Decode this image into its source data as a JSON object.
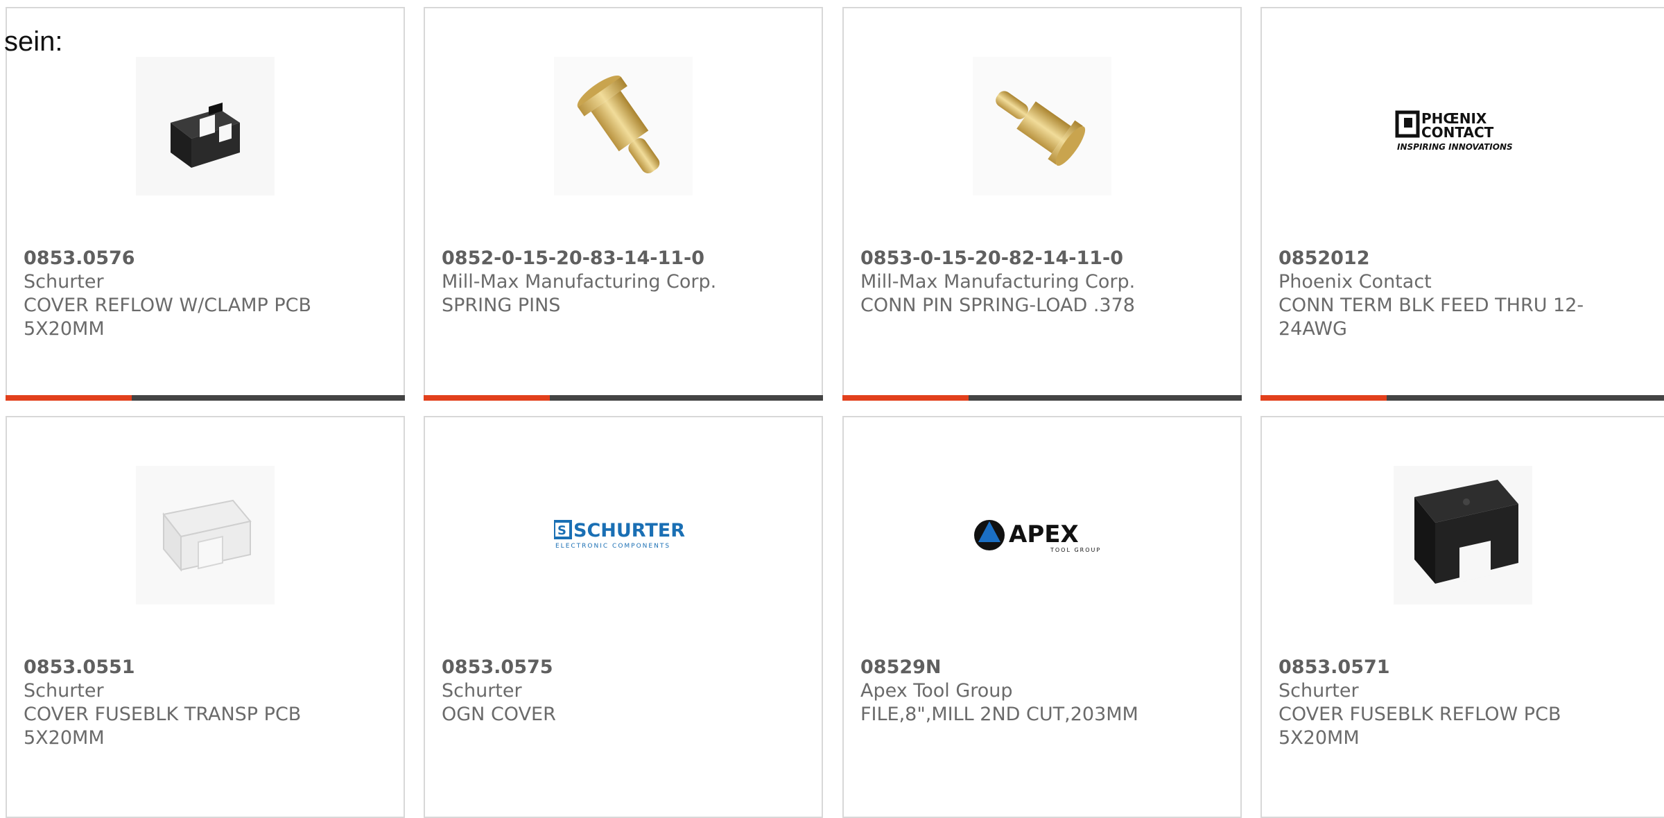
{
  "intro_text": "sein:",
  "products": [
    {
      "part_number": "0853.0576",
      "manufacturer": "Schurter",
      "description": "COVER REFLOW W/CLAMP PCB 5X20MM",
      "image": "black-fuse-clamp"
    },
    {
      "part_number": "0852-0-15-20-83-14-11-0",
      "manufacturer": "Mill-Max Manufacturing Corp.",
      "description": "SPRING PINS",
      "image": "gold-spring-pin"
    },
    {
      "part_number": "0853-0-15-20-82-14-11-0",
      "manufacturer": "Mill-Max Manufacturing Corp.",
      "description": "CONN PIN SPRING-LOAD .378",
      "image": "gold-spring-pin"
    },
    {
      "part_number": "0852012",
      "manufacturer": "Phoenix Contact",
      "description": "CONN TERM BLK FEED THRU 12-24AWG",
      "image": "phoenix-contact-logo"
    },
    {
      "part_number": "0853.0551",
      "manufacturer": "Schurter",
      "description": "COVER FUSEBLK TRANSP PCB 5X20MM",
      "image": "transparent-fuse-cover"
    },
    {
      "part_number": "0853.0575",
      "manufacturer": "Schurter",
      "description": "OGN COVER",
      "image": "schurter-logo"
    },
    {
      "part_number": "08529N",
      "manufacturer": "Apex Tool Group",
      "description": "FILE,8\",MILL 2ND CUT,203MM",
      "image": "apex-tool-group-logo"
    },
    {
      "part_number": "0853.0571",
      "manufacturer": "Schurter",
      "description": "COVER FUSEBLK REFLOW PCB 5X20MM",
      "image": "black-fuse-cover"
    }
  ],
  "logos": {
    "phoenix_line1": "PHŒNIX",
    "phoenix_line2": "CONTACT",
    "phoenix_tagline": "INSPIRING INNOVATIONS",
    "schurter_name": "SCHURTER",
    "schurter_tagline": "ELECTRONIC COMPONENTS",
    "apex_name": "APEX",
    "apex_tagline": "TOOL GROUP"
  },
  "colors": {
    "accent": "#e2401c",
    "bar": "#444444",
    "card_border": "#d8d8d8",
    "text": "#5f5f5f",
    "schurter_blue": "#1a6fb4",
    "gold": "#d9b860"
  }
}
